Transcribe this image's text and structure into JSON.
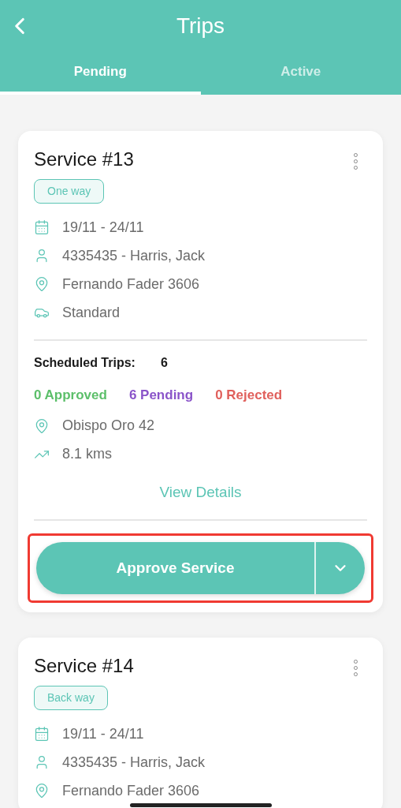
{
  "header": {
    "title": "Trips"
  },
  "tabs": [
    {
      "label": "Pending",
      "selected": true
    },
    {
      "label": "Active",
      "selected": false
    }
  ],
  "services": [
    {
      "title": "Service #13",
      "badge": "One way",
      "details": [
        {
          "kind": "calendar",
          "text": "19/11 - 24/11"
        },
        {
          "kind": "person",
          "text": "4335435 - Harris, Jack"
        },
        {
          "kind": "pin",
          "text": "Fernando Fader 3606"
        },
        {
          "kind": "car",
          "text": "Standard"
        }
      ],
      "scheduled": {
        "label": "Scheduled Trips:",
        "value": "6"
      },
      "counts": [
        {
          "kind": "approved",
          "text": "0 Approved"
        },
        {
          "kind": "pending",
          "text": "6 Pending"
        },
        {
          "kind": "rejected",
          "text": "0 Rejected"
        }
      ],
      "route": [
        {
          "kind": "pin",
          "text": "Obispo Oro 42"
        },
        {
          "kind": "trend",
          "text": "8.1 kms"
        }
      ],
      "link": "View Details",
      "action": {
        "label": "Approve Service",
        "highlighted": true
      }
    },
    {
      "title": "Service #14",
      "badge": "Back way",
      "details": [
        {
          "kind": "calendar",
          "text": "19/11 - 24/11"
        },
        {
          "kind": "person",
          "text": "4335435 - Harris, Jack"
        },
        {
          "kind": "pin",
          "text": "Fernando Fader 3606"
        }
      ]
    }
  ]
}
